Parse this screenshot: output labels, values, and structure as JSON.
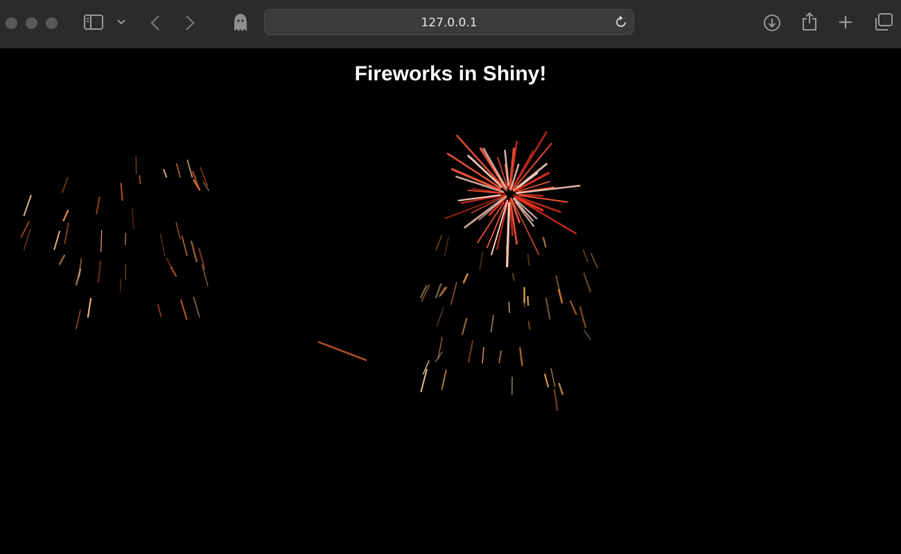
{
  "browser": {
    "url": "127.0.0.1",
    "icons": {
      "sidebar": "sidebar-icon",
      "chevron": "chevron-down-icon",
      "back": "back-arrow-icon",
      "forward": "forward-arrow-icon",
      "ghost": "ghost-privacy-icon",
      "reload": "reload-icon",
      "download": "download-icon",
      "share": "share-icon",
      "new_tab": "plus-icon",
      "tabs": "tab-overview-icon"
    }
  },
  "page": {
    "title": "Fireworks in Shiny!",
    "background": "#000000",
    "title_color": "#ffffff",
    "fireworks": [
      {
        "name": "red-burst",
        "colors": [
          "#e8321e",
          "#ff5a3c",
          "#ffd0c0"
        ]
      },
      {
        "name": "orange-shower-center",
        "colors": [
          "#e0842e",
          "#f0a85a",
          "#ffd8a0"
        ]
      },
      {
        "name": "orange-shower-left",
        "colors": [
          "#d8602a",
          "#e8904a",
          "#ffc890"
        ]
      }
    ]
  }
}
